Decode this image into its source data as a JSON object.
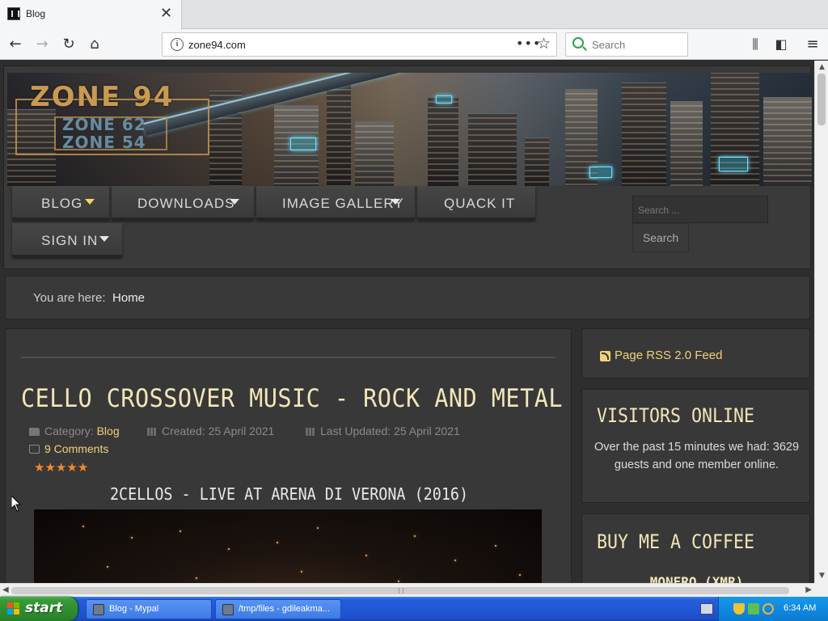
{
  "browser": {
    "tab_title": "Blog",
    "url": "zone94.com",
    "search_placeholder": "Search"
  },
  "site": {
    "logo_main": "ZONE 94",
    "logo_sub1": "ZONE 62",
    "logo_sub2": "ZONE 54",
    "menu": [
      {
        "label": "BLOG",
        "active": true,
        "has_dropdown": true
      },
      {
        "label": "DOWNLOADS",
        "has_dropdown": true
      },
      {
        "label": "IMAGE GALLERY",
        "has_dropdown": true
      },
      {
        "label": "QUACK IT",
        "has_dropdown": false
      },
      {
        "label": "SIGN IN",
        "has_dropdown": true
      }
    ],
    "search_placeholder": "Search ...",
    "search_button": "Search"
  },
  "breadcrumb": {
    "prefix": "You are here:",
    "current": "Home"
  },
  "article": {
    "title": "CELLO CROSSOVER MUSIC - ROCK AND METAL",
    "category_label": "Category:",
    "category": "Blog",
    "created": "Created: 25 April 2021",
    "updated": "Last Updated: 25 April 2021",
    "comments": "9 Comments",
    "rating_stars": 5,
    "video_title": "2CELLOS - LIVE AT ARENA DI VERONA (2016)"
  },
  "sidebar": {
    "rss_label": "Page RSS 2.0 Feed",
    "visitors_title": "VISITORS ONLINE",
    "visitors_text": "Over the past 15 minutes we had: 3629 guests and one member online.",
    "coffee_title": "BUY ME A COFFEE",
    "coffee_sub": "MONERO (XMR)"
  },
  "taskbar": {
    "start_label": "start",
    "tasks": [
      "Blog - Mypal",
      "/tmp/files - gdileakma..."
    ],
    "clock": "6:34 AM"
  },
  "colors": {
    "accent_gold": "#f0d27a",
    "title_cream": "#f1e6b8",
    "star_orange": "#f08a2a",
    "xp_blue": "#245edb",
    "xp_green": "#379a37"
  }
}
